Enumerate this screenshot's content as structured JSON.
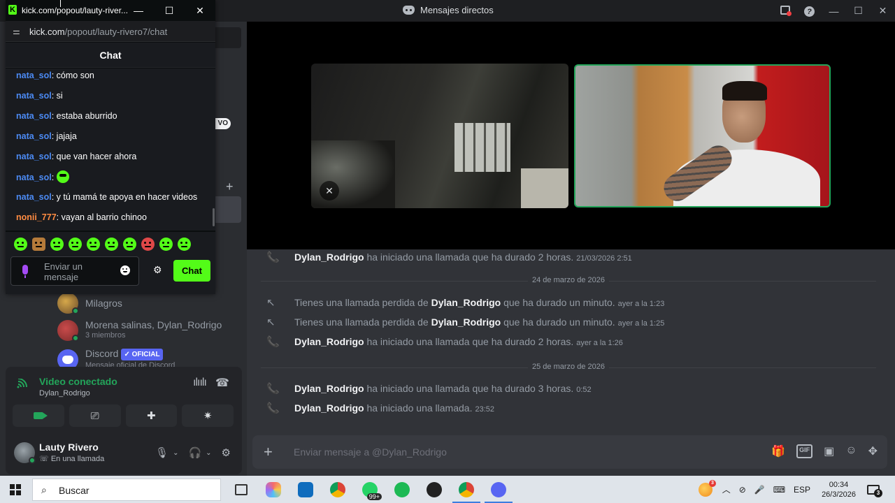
{
  "discord": {
    "window_title": "Mensajes directos",
    "sidebar": {
      "pill_text": "VO",
      "dms": [
        {
          "name": "Milagros",
          "sub": ""
        },
        {
          "name": "Morena salinas, Dylan_Rodrigo",
          "sub": "3 miembros"
        },
        {
          "name": "Discord",
          "badge": "✓ OFICIAL",
          "sub": "Mensaje oficial de Discord"
        }
      ]
    },
    "voice": {
      "title": "Video conectado",
      "channel": "Dylan_Rodrigo"
    },
    "user": {
      "name": "Lauty Rivero",
      "status": "En una llamada"
    },
    "messages": [
      {
        "type": "call",
        "icon": "phone-icon",
        "who": "Dylan_Rodrigo",
        "text": " ha iniciado una llamada que ha durado 2 horas.",
        "ts": "21/03/2026 2:51"
      },
      {
        "type": "divider",
        "text": "24 de marzo de 2026"
      },
      {
        "type": "missed",
        "icon": "missed-call-icon",
        "pre": "Tienes una llamada perdida de ",
        "who": "Dylan_Rodrigo",
        "text": " que ha durado un minuto.",
        "ts": "ayer a la 1:23"
      },
      {
        "type": "missed",
        "icon": "missed-call-icon",
        "pre": "Tienes una llamada perdida de ",
        "who": "Dylan_Rodrigo",
        "text": " que ha durado un minuto.",
        "ts": "ayer a la 1:25"
      },
      {
        "type": "call",
        "icon": "phone-icon",
        "who": "Dylan_Rodrigo",
        "text": " ha iniciado una llamada que ha durado 2 horas.",
        "ts": "ayer a la 1:26"
      },
      {
        "type": "divider",
        "text": "25 de marzo de 2026"
      },
      {
        "type": "call",
        "icon": "phone-icon",
        "who": "Dylan_Rodrigo",
        "text": " ha iniciado una llamada que ha durado 3 horas.",
        "ts": "0:52"
      },
      {
        "type": "call",
        "icon": "phone-icon",
        "who": "Dylan_Rodrigo",
        "text": " ha iniciado una llamada.",
        "ts": "23:52"
      }
    ],
    "composer": {
      "placeholder": "Enviar mensaje a @Dylan_Rodrigo"
    }
  },
  "kick": {
    "window_title": "kick.com/popout/lauty-river...",
    "url_domain": "kick.com",
    "url_path": "/popout/lauty-rivero7/chat",
    "header": "Chat",
    "chat": [
      {
        "user": "nata_sol",
        "color": "blue",
        "text": ": cómo son"
      },
      {
        "user": "nata_sol",
        "color": "blue",
        "text": ": si"
      },
      {
        "user": "nata_sol",
        "color": "blue",
        "text": ": estaba aburrido"
      },
      {
        "user": "nata_sol",
        "color": "blue",
        "text": ": jajaja"
      },
      {
        "user": "nata_sol",
        "color": "blue",
        "text": ": que van hacer ahora"
      },
      {
        "user": "nata_sol",
        "color": "blue",
        "text": ":",
        "emote": true
      },
      {
        "user": "nata_sol",
        "color": "blue",
        "text": ": y tú mamá te apoya en hacer videos"
      },
      {
        "user": "nonii_777",
        "color": "orange",
        "text": ": vayan al barrio chinoo"
      }
    ],
    "input_placeholder": "Enviar un mensaje",
    "send_label": "Chat"
  },
  "taskbar": {
    "search_label": "Buscar",
    "whatsapp_badge": "99+",
    "firefox_badge": "3",
    "lang": "ESP",
    "time": "00:34",
    "date": "26/3/2026",
    "notif_count": "3"
  }
}
